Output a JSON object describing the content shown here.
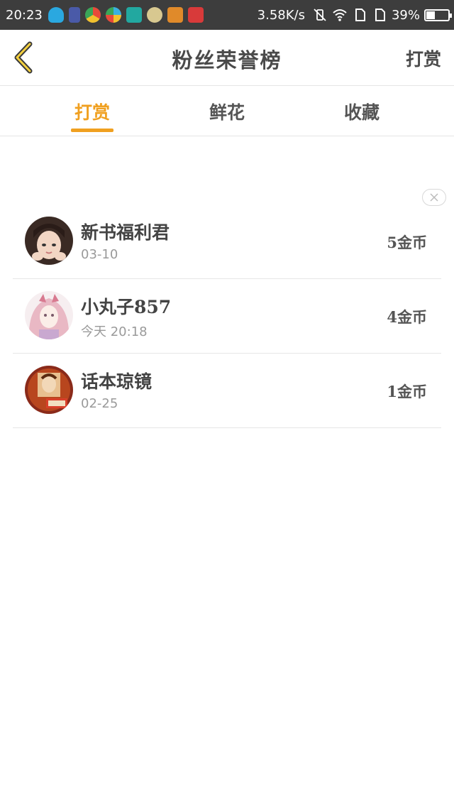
{
  "status_bar": {
    "time": "20:23",
    "net_speed": "3.58K/s",
    "battery_percent": "39%",
    "battery_level": 0.39,
    "notification_icons": [
      "qq-icon",
      "tower-icon",
      "chrome-icon",
      "play-icon",
      "scan-icon",
      "monkey-icon",
      "mail-icon",
      "qiku-icon"
    ]
  },
  "header": {
    "title": "粉丝荣誉榜",
    "action_label": "打赏"
  },
  "tabs": [
    {
      "label": "打赏",
      "active": true
    },
    {
      "label": "鲜花",
      "active": false
    },
    {
      "label": "收藏",
      "active": false
    }
  ],
  "list": [
    {
      "name": "新书福利君",
      "date": "03-10",
      "amount": "5金币"
    },
    {
      "name": "小丸子857",
      "date": "今天 20:18",
      "amount": "4金币"
    },
    {
      "name": "话本琼镜",
      "date": "02-25",
      "amount": "1金币"
    }
  ],
  "colors": {
    "accent": "#f0a020",
    "status_bar_bg": "#3d3d3d",
    "text": "#4a4a4a"
  }
}
